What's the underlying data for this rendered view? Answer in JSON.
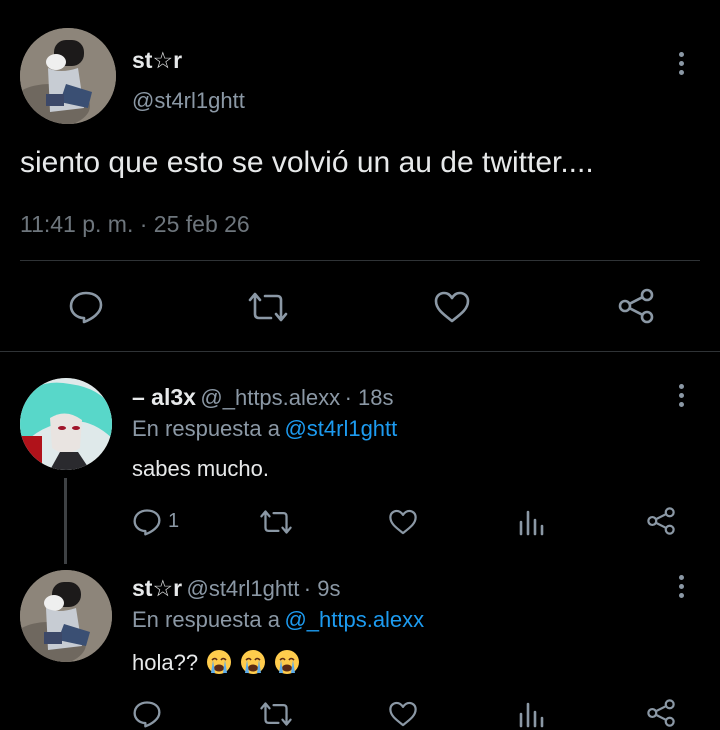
{
  "main_tweet": {
    "display_name": "st☆r",
    "handle": "@st4rl1ghtt",
    "text": "siento que esto se volvió un au de twitter....",
    "timestamp": "11:41 p. m. · 25 feb 26",
    "actions": [
      "reply-icon",
      "retweet-icon",
      "like-icon",
      "share-icon"
    ]
  },
  "replies": [
    {
      "display_name": "– al3x",
      "handle": "@_https.alexx",
      "time": "· 18s",
      "reply_prefix": "En respuesta a",
      "reply_to": "@st4rl1ghtt",
      "text": "sabes mucho.",
      "reply_count": "1"
    },
    {
      "display_name": "st☆r",
      "handle": "@st4rl1ghtt",
      "time": "· 9s",
      "reply_prefix": "En respuesta a",
      "reply_to": "@_https.alexx",
      "text": "hola??",
      "emoji": [
        "loudly-crying-face",
        "loudly-crying-face",
        "loudly-crying-face"
      ]
    }
  ],
  "colors": {
    "background": "#000000",
    "text": "#e7e9ea",
    "secondary": "#8b98a5",
    "link": "#1d9bf0",
    "divider": "#2f3336"
  }
}
